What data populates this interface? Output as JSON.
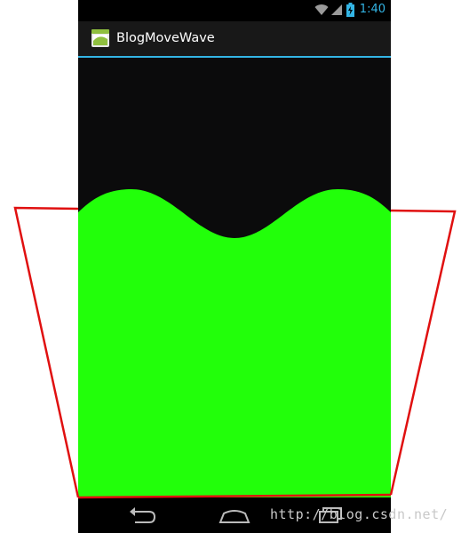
{
  "status_bar": {
    "time": "1:40",
    "icons": [
      "wifi-icon",
      "signal-icon",
      "battery-charging-icon"
    ],
    "clock_color": "#33b5e5"
  },
  "action_bar": {
    "app_icon": "android-app-icon",
    "title": "BlogMoveWave",
    "divider_color": "#33b5e5"
  },
  "wave": {
    "fill_color": "#22ff0a",
    "background_color": "#0b0b0c"
  },
  "nav_bar": {
    "buttons": [
      "back-icon",
      "home-icon",
      "recents-icon"
    ]
  },
  "annotation": {
    "outline_color": "#e01010",
    "shape": "trapezoid-container"
  },
  "watermark": {
    "text": "http://blog.csdn.net/"
  }
}
